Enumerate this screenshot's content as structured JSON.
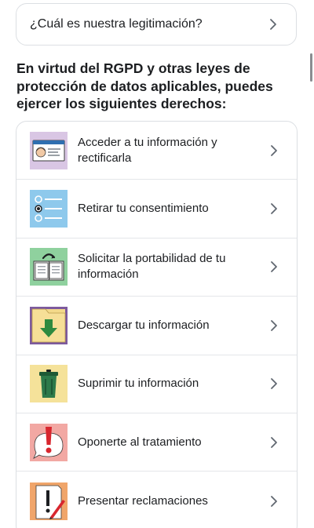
{
  "legitimation": {
    "label": "¿Cuál es nuestra legitimación?"
  },
  "rights_heading": "En virtud del RGPD y otras leyes de protección de datos aplicables, puedes ejercer los siguientes derechos:",
  "rights": [
    {
      "label": "Acceder a tu información y rectificarla",
      "icon": "id-card-icon"
    },
    {
      "label": "Retirar tu consentimiento",
      "icon": "checklist-icon"
    },
    {
      "label": "Solicitar la portabilidad de tu información",
      "icon": "book-transfer-icon"
    },
    {
      "label": "Descargar tu información",
      "icon": "folder-download-icon"
    },
    {
      "label": "Suprimir tu información",
      "icon": "trash-can-icon"
    },
    {
      "label": "Oponerte al tratamiento",
      "icon": "exclamation-bubble-icon"
    },
    {
      "label": "Presentar reclamaciones",
      "icon": "document-exclamation-icon"
    }
  ],
  "colors": {
    "text": "#1c1e21",
    "border": "#dcdfe3",
    "chevron": "#606770"
  }
}
